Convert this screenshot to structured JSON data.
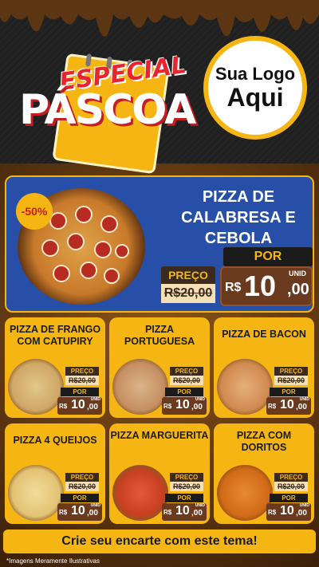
{
  "title": {
    "line1": "ESPECIAL",
    "line2": "PÁSCOA"
  },
  "logo": {
    "line1": "Sua Logo",
    "line2": "Aqui"
  },
  "featured": {
    "discount": "-50%",
    "name": "PIZZA DE CALABRESA E CEBOLA",
    "preco_label": "PREÇO",
    "old_price": "R$20,00",
    "por_label": "POR",
    "currency": "R$",
    "price_int": "10",
    "price_dec": ",00",
    "unid": "UNID"
  },
  "cards": [
    {
      "name": "PIZZA DE FRANGO COM CATUPIRY",
      "preco": "PREÇO",
      "old": "R$20,00",
      "por": "POR",
      "cur": "R$",
      "int": "10",
      "dec": ",00",
      "unid": "UNID"
    },
    {
      "name": "PIZZA PORTUGUESA",
      "preco": "PREÇO",
      "old": "R$20,00",
      "por": "POR",
      "cur": "R$",
      "int": "10",
      "dec": ",00",
      "unid": "UNID"
    },
    {
      "name": "PIZZA DE BACON",
      "preco": "PREÇO",
      "old": "R$20,00",
      "por": "POR",
      "cur": "R$",
      "int": "10",
      "dec": ",00",
      "unid": "UNID"
    },
    {
      "name": "PIZZA 4 QUEIJOS",
      "preco": "PREÇO",
      "old": "R$20,00",
      "por": "POR",
      "cur": "R$",
      "int": "10",
      "dec": ",00",
      "unid": "UNID"
    },
    {
      "name": "PIZZA MARGUERITA",
      "preco": "PREÇO",
      "old": "R$20,00",
      "por": "POR",
      "cur": "R$",
      "int": "10",
      "dec": ",00",
      "unid": "UNID"
    },
    {
      "name": "PIZZA COM DORITOS",
      "preco": "PREÇO",
      "old": "R$20,00",
      "por": "POR",
      "cur": "R$",
      "int": "10",
      "dec": ",00",
      "unid": "UNID"
    }
  ],
  "footer": "Crie seu encarte com este tema!",
  "disclaimer": "*Imagens Meramente Ilustrativas",
  "colors": {
    "accent": "#f5b513",
    "blue": "#284fa8",
    "chocolate": "#6a3a1e",
    "red": "#c41d24"
  }
}
